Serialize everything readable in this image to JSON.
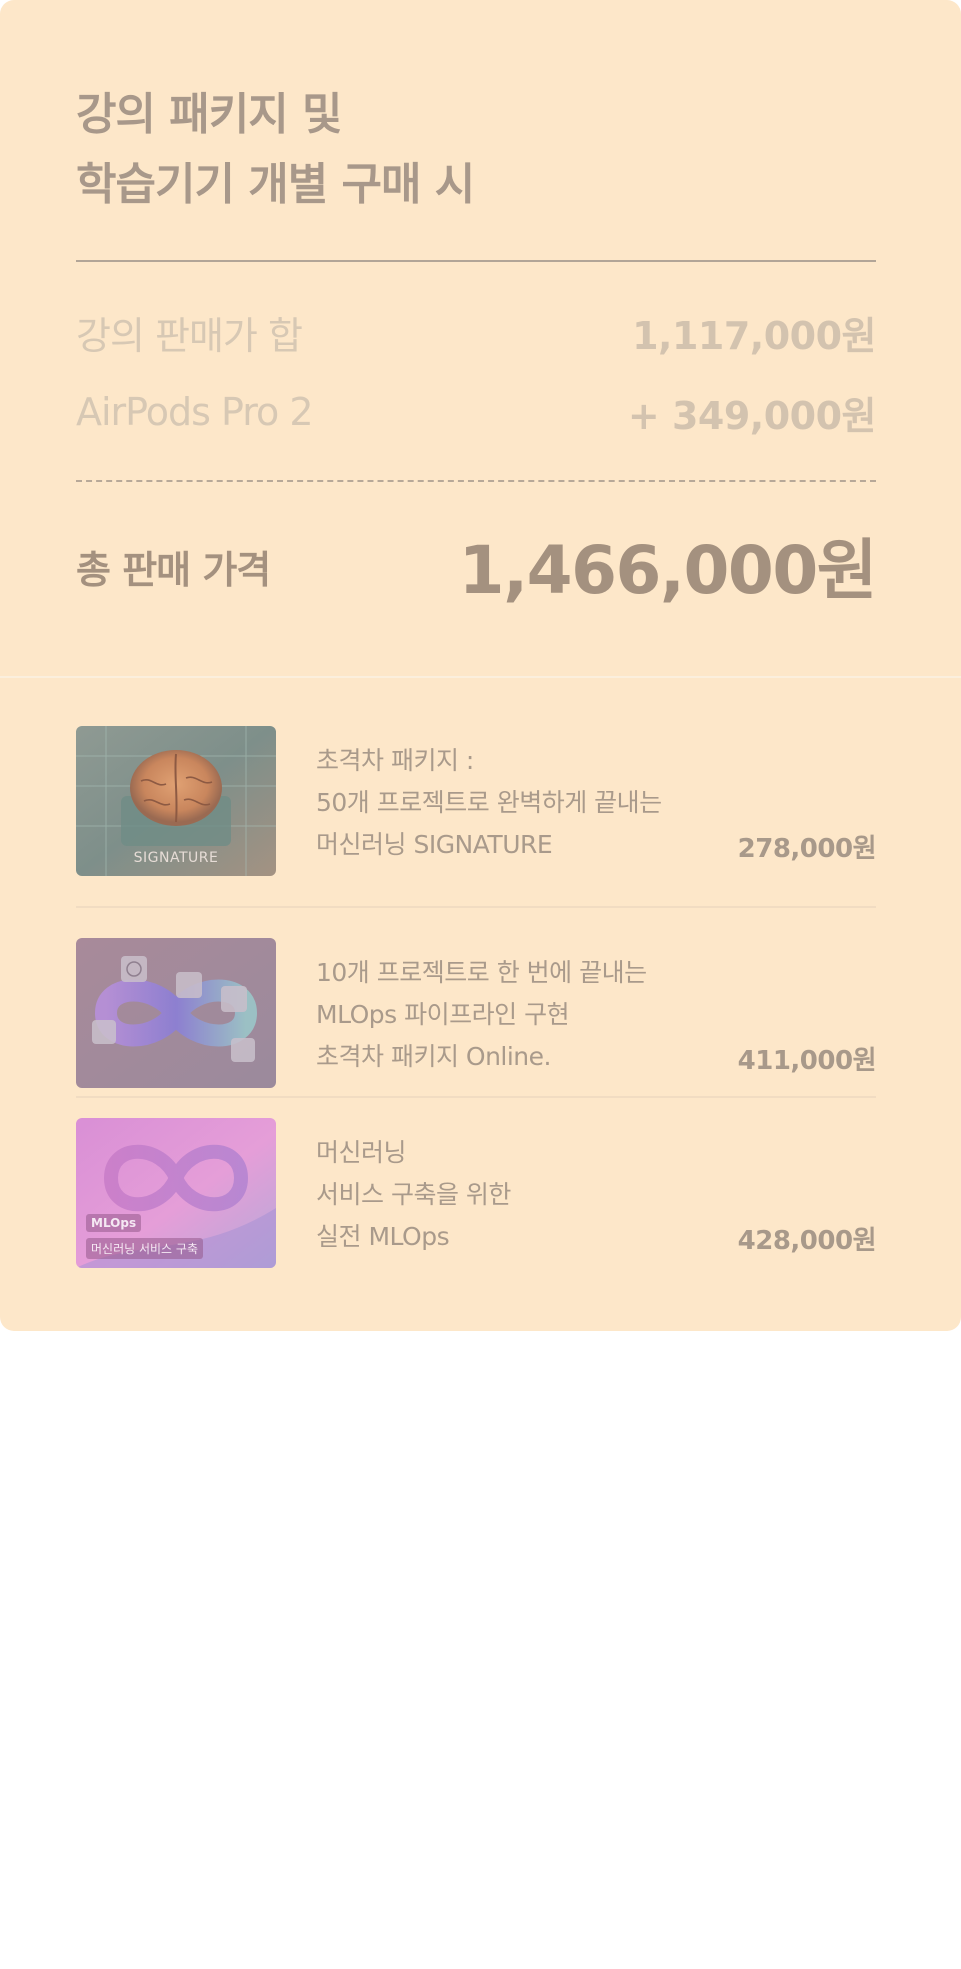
{
  "summary": {
    "title_line_1": "강의 패키지 및",
    "title_line_2": "학습기기 개별 구매 시",
    "rows": [
      {
        "label": "강의 판매가 합",
        "value": "1,117,000원"
      },
      {
        "label": "AirPods Pro 2",
        "value": "+ 349,000원"
      }
    ],
    "total_label": "총 판매 가격",
    "total_value": "1,466,000원"
  },
  "items": [
    {
      "thumb_label": "SIGNATURE",
      "lines": [
        "초격차 패키지 :",
        "50개 프로젝트로 완벽하게 끝내는",
        "머신러닝 SIGNATURE"
      ],
      "price": "278,000원"
    },
    {
      "lines": [
        "10개 프로젝트로 한 번에 끝내는",
        "MLOps 파이프라인 구현",
        "초격차 패키지 Online."
      ],
      "price": "411,000원"
    },
    {
      "thumb_tag_1": "MLOps",
      "thumb_tag_2": "머신러닝 서비스 구축",
      "lines": [
        "머신러닝",
        "서비스 구축을 위한",
        "실전 MLOps"
      ],
      "price": "428,000원"
    }
  ],
  "colors": {
    "card_background": "#fde7c9",
    "title_text": "#a8988a",
    "muted_text": "#d7c8b4",
    "total_text": "#a4917f"
  }
}
